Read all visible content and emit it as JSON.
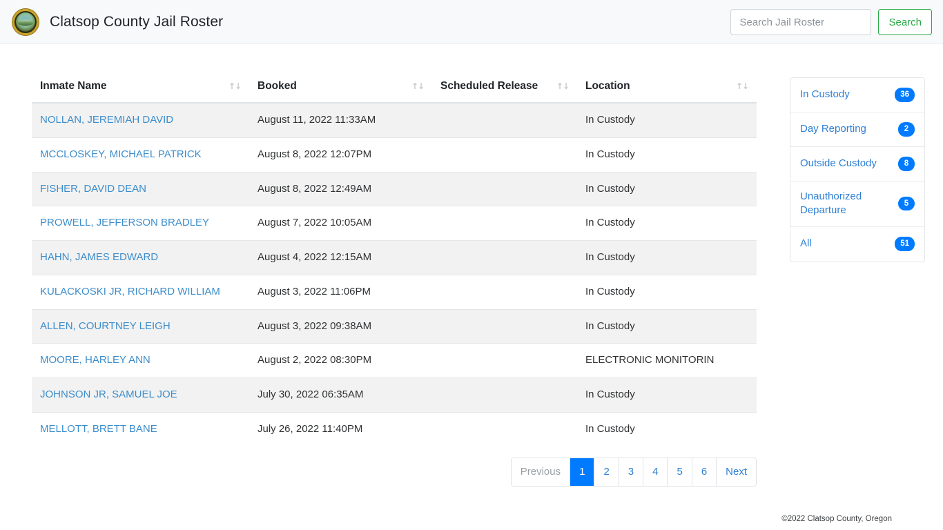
{
  "header": {
    "title": "Clatsop County Jail Roster",
    "logo_icon": "county-seal-icon",
    "search": {
      "placeholder": "Search Jail Roster",
      "value": "",
      "button_label": "Search"
    }
  },
  "table": {
    "sort_icon": "↑↓",
    "columns": [
      {
        "key": "name",
        "label": "Inmate Name"
      },
      {
        "key": "booked",
        "label": "Booked"
      },
      {
        "key": "release",
        "label": "Scheduled Release"
      },
      {
        "key": "location",
        "label": "Location"
      }
    ],
    "rows": [
      {
        "name": "NOLLAN, JEREMIAH DAVID",
        "booked": "August 11, 2022 11:33AM",
        "release": "",
        "location": "In Custody"
      },
      {
        "name": "MCCLOSKEY, MICHAEL PATRICK",
        "booked": "August 8, 2022 12:07PM",
        "release": "",
        "location": "In Custody"
      },
      {
        "name": "FISHER, DAVID DEAN",
        "booked": "August 8, 2022 12:49AM",
        "release": "",
        "location": "In Custody"
      },
      {
        "name": "PROWELL, JEFFERSON BRADLEY",
        "booked": "August 7, 2022 10:05AM",
        "release": "",
        "location": "In Custody"
      },
      {
        "name": "HAHN, JAMES EDWARD",
        "booked": "August 4, 2022 12:15AM",
        "release": "",
        "location": "In Custody"
      },
      {
        "name": "KULACKOSKI JR, RICHARD WILLIAM",
        "booked": "August 3, 2022 11:06PM",
        "release": "",
        "location": "In Custody"
      },
      {
        "name": "ALLEN, COURTNEY LEIGH",
        "booked": "August 3, 2022 09:38AM",
        "release": "",
        "location": "In Custody"
      },
      {
        "name": "MOORE, HARLEY ANN",
        "booked": "August 2, 2022 08:30PM",
        "release": "",
        "location": "ELECTRONIC MONITORIN"
      },
      {
        "name": "JOHNSON JR, SAMUEL JOE",
        "booked": "July 30, 2022 06:35AM",
        "release": "",
        "location": "In Custody"
      },
      {
        "name": "MELLOTT, BRETT BANE",
        "booked": "July 26, 2022 11:40PM",
        "release": "",
        "location": "In Custody"
      }
    ]
  },
  "pagination": {
    "previous_label": "Previous",
    "next_label": "Next",
    "pages": [
      "1",
      "2",
      "3",
      "4",
      "5",
      "6"
    ],
    "active_page": "1",
    "previous_disabled": true
  },
  "filters": {
    "items": [
      {
        "label": "In Custody",
        "count": "36"
      },
      {
        "label": "Day Reporting",
        "count": "2"
      },
      {
        "label": "Outside Custody",
        "count": "8"
      },
      {
        "label": "Unauthorized Departure",
        "count": "5"
      },
      {
        "label": "All",
        "count": "51"
      }
    ]
  },
  "footer": {
    "copyright": "©2022 Clatsop County, Oregon"
  },
  "colors": {
    "link": "#3c8dcb",
    "badge": "#007bff",
    "active_page": "#007bff",
    "search_button": "#28a745",
    "header_bg": "#f8f9fa",
    "row_stripe": "#f2f2f2"
  }
}
